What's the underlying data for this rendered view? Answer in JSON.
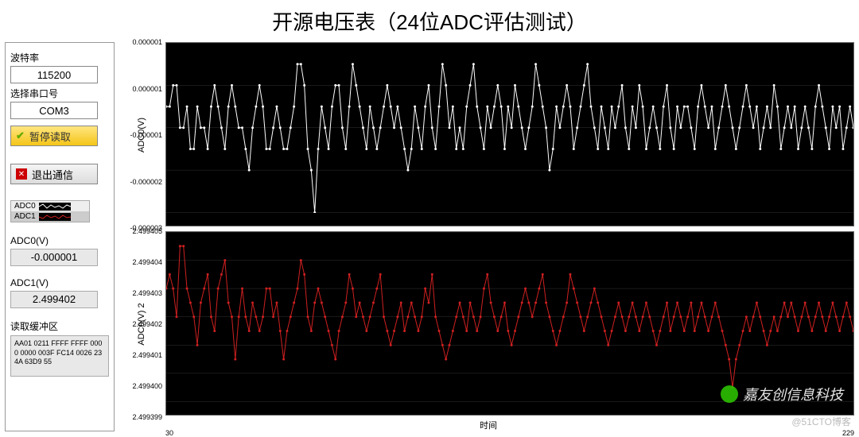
{
  "title": "开源电压表（24位ADC评估测试）",
  "sidebar": {
    "baud_label": "波特率",
    "baud_value": "115200",
    "port_label": "选择串口号",
    "port_value": "COM3",
    "pause_btn": "暂停读取",
    "exit_btn": "退出通信",
    "legend": {
      "adc0": "ADC0",
      "adc1": "ADC1"
    },
    "adc0_label": "ADC0(V)",
    "adc0_value": "-0.000001",
    "adc1_label": "ADC1(V)",
    "adc1_value": "2.499402",
    "buffer_label": "读取缓冲区",
    "buffer_value": "AA01 0211 FFFF FFFF 0000 0000 003F FC14 0026 234A 63D9 55"
  },
  "chart_data": [
    {
      "type": "line",
      "ylabel": "ADC0(V)",
      "ylim": [
        -3e-06,
        1e-06
      ],
      "yticks": [
        1e-06,
        1e-06,
        -1e-06,
        -2e-06,
        -3e-06
      ],
      "yticks_pos": [
        0,
        25,
        50,
        75,
        100
      ],
      "yticks_labels": [
        "0.000001",
        "0.000001",
        "-0.000001",
        "-0.000002",
        "-0.000003"
      ],
      "xlim": [
        30,
        229
      ],
      "color": "#ffffff",
      "values": [
        -5e-07,
        -5e-07,
        0,
        0,
        -1e-06,
        -1e-06,
        -5e-07,
        -1.5e-06,
        -1.5e-06,
        -5e-07,
        -1e-06,
        -1e-06,
        -1.5e-06,
        -5e-07,
        0,
        -5e-07,
        -1e-06,
        -1.5e-06,
        -5e-07,
        0,
        -5e-07,
        -1e-06,
        -1e-06,
        -1.5e-06,
        -2e-06,
        -1e-06,
        -5e-07,
        0,
        -5e-07,
        -1.5e-06,
        -1.5e-06,
        -1e-06,
        -5e-07,
        -1e-06,
        -1.5e-06,
        -1.5e-06,
        -1e-06,
        -5e-07,
        5e-07,
        5e-07,
        0,
        -1.5e-06,
        -2e-06,
        -3e-06,
        -1.5e-06,
        -5e-07,
        -1e-06,
        -1.5e-06,
        -5e-07,
        0,
        0,
        -1e-06,
        -1.5e-06,
        -5e-07,
        5e-07,
        0,
        -5e-07,
        -1e-06,
        -1.5e-06,
        -5e-07,
        -1e-06,
        -1.5e-06,
        -1e-06,
        -5e-07,
        0,
        -5e-07,
        -1e-06,
        -5e-07,
        -1e-06,
        -1.5e-06,
        -2e-06,
        -1.5e-06,
        -5e-07,
        -1e-06,
        -1.5e-06,
        -5e-07,
        0,
        -1e-06,
        -1.5e-06,
        -5e-07,
        5e-07,
        0,
        -1e-06,
        -5e-07,
        -1.5e-06,
        -1e-06,
        -1.5e-06,
        -5e-07,
        0,
        5e-07,
        -5e-07,
        -1e-06,
        -1.5e-06,
        -5e-07,
        -1e-06,
        -5e-07,
        0,
        -5e-07,
        -1.5e-06,
        -5e-07,
        -1e-06,
        0,
        -5e-07,
        -1e-06,
        -1.5e-06,
        -1e-06,
        -5e-07,
        5e-07,
        0,
        -5e-07,
        -1e-06,
        -2e-06,
        -1.5e-06,
        -5e-07,
        -1e-06,
        -5e-07,
        0,
        -5e-07,
        -1.5e-06,
        -1e-06,
        -5e-07,
        0,
        5e-07,
        -5e-07,
        -1e-06,
        -1.5e-06,
        -5e-07,
        -1e-06,
        -1.5e-06,
        -5e-07,
        -1e-06,
        -5e-07,
        0,
        -1e-06,
        -1.5e-06,
        -5e-07,
        -1e-06,
        0,
        -5e-07,
        -1.5e-06,
        -1e-06,
        -5e-07,
        -1e-06,
        -1.5e-06,
        -5e-07,
        0,
        -1e-06,
        -1.5e-06,
        -5e-07,
        -1e-06,
        -5e-07,
        -5e-07,
        -1e-06,
        -1.5e-06,
        -5e-07,
        0,
        -5e-07,
        -1e-06,
        -5e-07,
        -1.5e-06,
        -1e-06,
        -5e-07,
        0,
        -5e-07,
        -1e-06,
        -1.5e-06,
        -1e-06,
        -5e-07,
        0,
        -5e-07,
        -1e-06,
        -5e-07,
        -1.5e-06,
        -1e-06,
        -5e-07,
        -1e-06,
        0,
        -5e-07,
        -1.5e-06,
        -1e-06,
        -5e-07,
        -1e-06,
        -5e-07,
        -1.5e-06,
        -1e-06,
        -5e-07,
        -1e-06,
        -1.5e-06,
        -5e-07,
        0,
        -5e-07,
        -1e-06,
        -1.5e-06,
        -5e-07,
        -1e-06,
        -5e-07,
        -1.5e-06,
        -1e-06,
        -5e-07,
        -1e-06
      ]
    },
    {
      "type": "line",
      "ylabel": "ADC0(V) 2",
      "ylim": [
        2.499399,
        2.499405
      ],
      "yticks_labels": [
        "2.499405",
        "2.499404",
        "2.499403",
        "2.499402",
        "2.499401",
        "2.499400",
        "2.499399"
      ],
      "yticks_pos": [
        0,
        16.7,
        33.3,
        50,
        66.7,
        83.3,
        100
      ],
      "xlim": [
        30,
        229
      ],
      "xlabel": "时间",
      "color": "#d02020",
      "values": [
        2.499403,
        2.4994035,
        2.499403,
        2.499402,
        2.4994045,
        2.4994045,
        2.499403,
        2.4994025,
        2.499402,
        2.499401,
        2.4994025,
        2.499403,
        2.4994035,
        2.499402,
        2.4994015,
        2.499403,
        2.4994035,
        2.499404,
        2.4994025,
        2.499402,
        2.4994005,
        2.499402,
        2.499403,
        2.499402,
        2.4994015,
        2.4994025,
        2.499402,
        2.4994015,
        2.499402,
        2.499403,
        2.499403,
        2.499402,
        2.4994025,
        2.4994015,
        2.4994005,
        2.4994015,
        2.499402,
        2.4994025,
        2.499403,
        2.499404,
        2.4994035,
        2.499402,
        2.4994015,
        2.4994025,
        2.499403,
        2.4994025,
        2.499402,
        2.4994015,
        2.499401,
        2.4994005,
        2.4994015,
        2.499402,
        2.4994025,
        2.4994035,
        2.499403,
        2.499402,
        2.4994025,
        2.499402,
        2.4994015,
        2.499402,
        2.4994025,
        2.499403,
        2.4994035,
        2.499402,
        2.4994015,
        2.499401,
        2.4994015,
        2.499402,
        2.4994025,
        2.4994015,
        2.499402,
        2.4994025,
        2.499402,
        2.4994015,
        2.499402,
        2.499403,
        2.4994025,
        2.4994035,
        2.499402,
        2.4994015,
        2.499401,
        2.4994005,
        2.499401,
        2.4994015,
        2.499402,
        2.4994025,
        2.499402,
        2.4994015,
        2.4994025,
        2.499402,
        2.4994015,
        2.499402,
        2.499403,
        2.4994035,
        2.4994025,
        2.499402,
        2.4994015,
        2.499402,
        2.4994025,
        2.4994015,
        2.499401,
        2.4994015,
        2.499402,
        2.4994025,
        2.499403,
        2.4994025,
        2.499402,
        2.4994025,
        2.499403,
        2.4994035,
        2.4994025,
        2.499402,
        2.4994015,
        2.499401,
        2.4994015,
        2.499402,
        2.4994025,
        2.4994035,
        2.499403,
        2.4994025,
        2.499402,
        2.4994015,
        2.499402,
        2.4994025,
        2.499403,
        2.4994025,
        2.499402,
        2.4994015,
        2.499401,
        2.4994015,
        2.499402,
        2.4994025,
        2.499402,
        2.4994015,
        2.499402,
        2.4994025,
        2.499402,
        2.4994015,
        2.499402,
        2.4994025,
        2.499402,
        2.4994015,
        2.499401,
        2.4994015,
        2.499402,
        2.4994025,
        2.4994015,
        2.499402,
        2.4994025,
        2.499402,
        2.4994015,
        2.499402,
        2.4994025,
        2.4994015,
        2.499402,
        2.4994025,
        2.499402,
        2.4994015,
        2.499402,
        2.4994025,
        2.499402,
        2.4994015,
        2.499401,
        2.4994005,
        2.4993995,
        2.4994005,
        2.499401,
        2.4994015,
        2.499402,
        2.4994015,
        2.499402,
        2.4994025,
        2.499402,
        2.4994015,
        2.499401,
        2.4994015,
        2.499402,
        2.4994015,
        2.499402,
        2.4994025,
        2.499402,
        2.4994025,
        2.499402,
        2.4994015,
        2.499402,
        2.4994025,
        2.499402,
        2.4994015,
        2.499402,
        2.4994025,
        2.499402,
        2.4994015,
        2.499402,
        2.4994025,
        2.499402,
        2.4994015,
        2.499402,
        2.4994025,
        2.499402,
        2.4994015
      ]
    }
  ],
  "watermarks": {
    "w1": "嘉友创信息科技",
    "w2": "@51CTO博客"
  }
}
